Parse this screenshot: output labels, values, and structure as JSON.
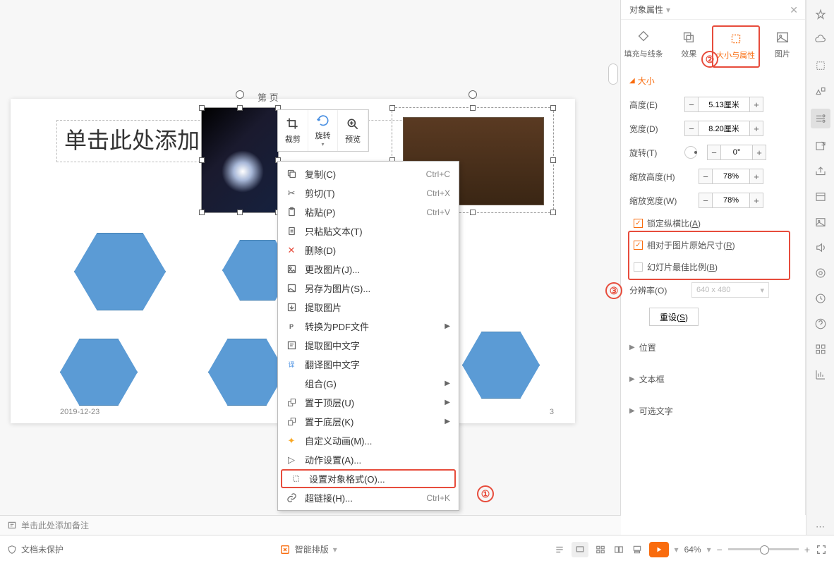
{
  "slide": {
    "header": "第    页",
    "title_placeholder": "单击此处添加",
    "footer_date": "2019-12-23",
    "page_num": "3"
  },
  "toolbar": {
    "crop": "裁剪",
    "rotate": "旋转",
    "preview": "预览"
  },
  "ctx": {
    "copy": "复制(C)",
    "copy_sc": "Ctrl+C",
    "cut": "剪切(T)",
    "cut_sc": "Ctrl+X",
    "paste": "粘贴(P)",
    "paste_sc": "Ctrl+V",
    "paste_text": "只粘贴文本(T)",
    "delete": "删除(D)",
    "change_pic": "更改图片(J)...",
    "save_as_pic": "另存为图片(S)...",
    "extract_pic": "提取图片",
    "to_pdf": "转换为PDF文件",
    "extract_text": "提取图中文字",
    "translate_text": "翻译图中文字",
    "group": "组合(G)",
    "bring_front": "置于顶层(U)",
    "send_back": "置于底层(K)",
    "custom_anim": "自定义动画(M)...",
    "action": "动作设置(A)...",
    "format_obj": "设置对象格式(O)...",
    "hyperlink": "超链接(H)...",
    "hyperlink_sc": "Ctrl+K"
  },
  "annotations": {
    "one": "①",
    "two": "②",
    "three": "③"
  },
  "notes_placeholder": "单击此处添加备注",
  "status": {
    "protect": "文档未保护",
    "smart_layout": "智能排版",
    "zoom": "64%"
  },
  "panel": {
    "title": "对象属性",
    "tabs": {
      "fill": "填充与线条",
      "effect": "效果",
      "size": "大小与属性",
      "pic": "图片"
    },
    "section_size": "大小",
    "height": "高度(E)",
    "height_v": "5.13厘米",
    "width": "宽度(D)",
    "width_v": "8.20厘米",
    "rotate": "旋转(T)",
    "rotate_v": "0°",
    "scale_h": "缩放高度(H)",
    "scale_h_v": "78%",
    "scale_w": "缩放宽度(W)",
    "scale_w_v": "78%",
    "lock_ratio": "锁定纵横比(A)",
    "rel_orig": "相对于图片原始尺寸(R)",
    "best_ratio": "幻灯片最佳比例(B)",
    "resolution": "分辨率(O)",
    "resolution_v": "640 x 480",
    "reset": "重设(S)",
    "pos": "位置",
    "textbox": "文本框",
    "alt_text": "可选文字"
  }
}
